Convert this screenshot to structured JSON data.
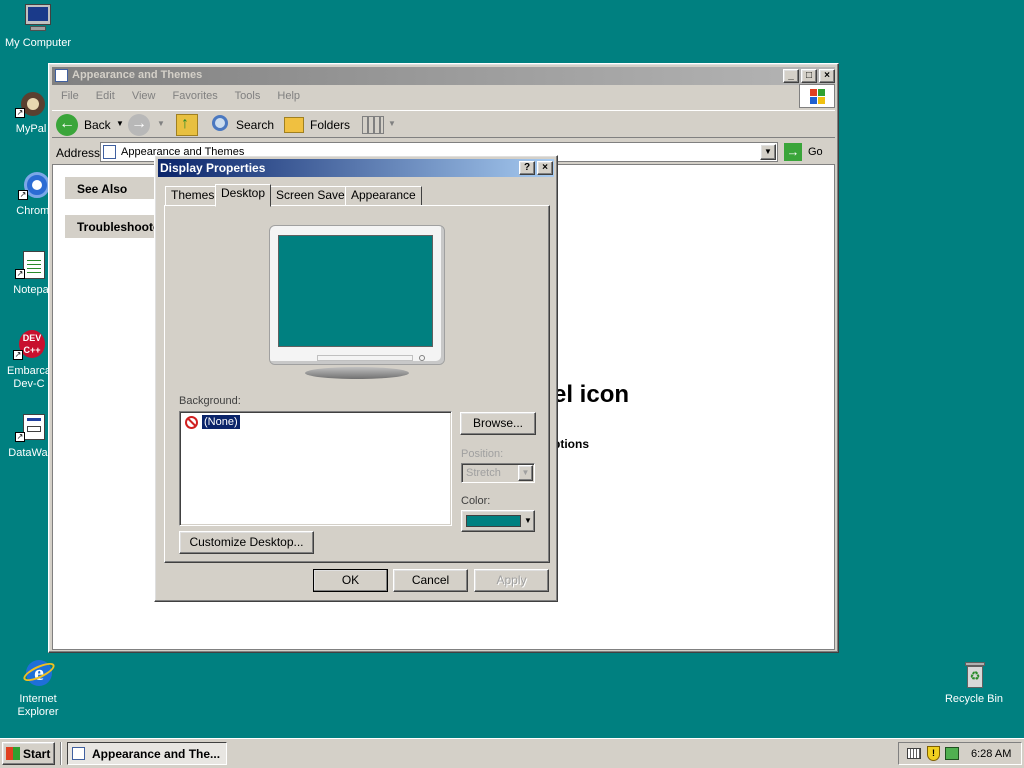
{
  "desktop": {
    "icons": [
      {
        "label1": "My Computer",
        "label2": ""
      },
      {
        "label1": "MyPal",
        "label2": ""
      },
      {
        "label1": "Chromi",
        "label2": ""
      },
      {
        "label1": "Notepa",
        "label2": ""
      },
      {
        "label1": "Embarca",
        "label2": "Dev-C"
      },
      {
        "label1": "DataWag",
        "label2": ""
      },
      {
        "label1": "Internet",
        "label2": "Explorer"
      },
      {
        "label1": "Recycle Bin",
        "label2": ""
      }
    ]
  },
  "explorer": {
    "title": "Appearance and Themes",
    "menu": [
      "File",
      "Edit",
      "View",
      "Favorites",
      "Tools",
      "Help"
    ],
    "toolbar": {
      "back": "Back",
      "search": "Search",
      "folders": "Folders"
    },
    "address_label": "Address",
    "address_value": "Appearance and Themes",
    "go": "Go",
    "side": {
      "see_also": "See Also",
      "troubleshoot": "Troubleshoote"
    },
    "content_heading": "el icon",
    "content_sub": "ptions"
  },
  "dialog": {
    "title": "Display Properties",
    "help_btn": "?",
    "close_btn": "×",
    "tabs": [
      "Themes",
      "Desktop",
      "Screen Saver",
      "Appearance"
    ],
    "active_tab": "Desktop",
    "background_label": "Background:",
    "background_items": [
      "(None)"
    ],
    "browse": "Browse...",
    "position_label": "Position:",
    "position_value": "Stretch",
    "color_label": "Color:",
    "color_value": "#008080",
    "customize": "Customize Desktop...",
    "ok": "OK",
    "cancel": "Cancel",
    "apply": "Apply"
  },
  "taskbar": {
    "start": "Start",
    "task": "Appearance and The...",
    "clock": "6:28 AM"
  },
  "colors": {
    "desktop": "#008080",
    "titlebar_active": "#0a246a",
    "titlebar_inactive": "#808080",
    "face": "#d4d0c8"
  }
}
